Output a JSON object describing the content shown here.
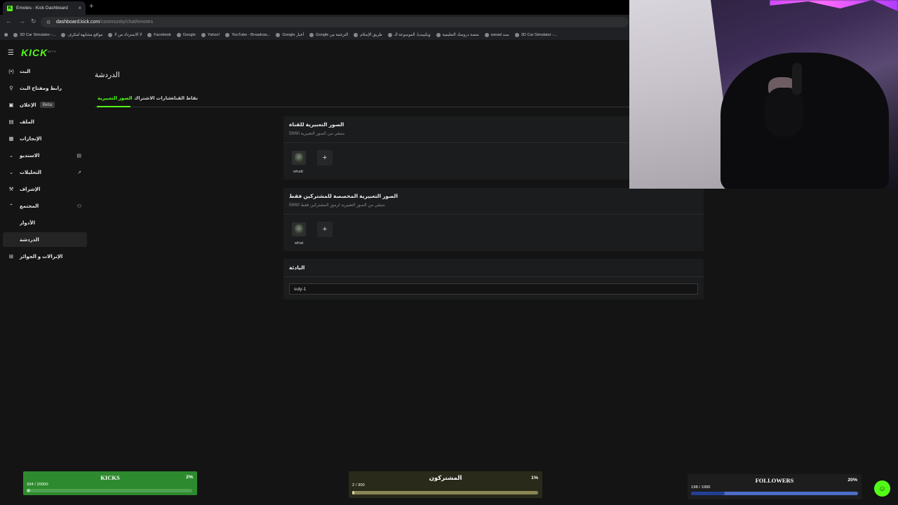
{
  "browser": {
    "tab_title": "Emotes - Kick Dashboard",
    "tab_close": "×",
    "new_tab": "+",
    "url_host": "dashboard.kick.com",
    "url_path": "/community/chat/emotes",
    "bookmarks": [
      "3D Car Simulator -...",
      "مواقع مشابهة لمكرف",
      "لا الاسترداد من لا",
      "Facebook",
      "Google",
      "Yahoo!",
      "YouTube - Broadcas...",
      "Google أخبار",
      "Google الترجمة من",
      "طريق الإسلام",
      "ويكيبيديا، الموسوعة الـ",
      "منصة دروسك التعليمية",
      "sanad سند",
      "3D Car Simulator -..."
    ]
  },
  "sidebar": {
    "logo": "KICK",
    "logo_badge": "BETA",
    "items": [
      {
        "label": "البث",
        "icon": "broadcast-icon",
        "glyph": "(•)"
      },
      {
        "label": "رابط ومفتاح البث",
        "icon": "link-icon",
        "glyph": "⚲"
      },
      {
        "label": "الإعلان",
        "icon": "ad-icon",
        "glyph": "▣",
        "badge": "Beta"
      },
      {
        "label": "الملف",
        "icon": "profile-icon",
        "glyph": "▤"
      },
      {
        "label": "الإنجازات",
        "icon": "achievements-icon",
        "glyph": "▦"
      },
      {
        "label": "الاستديو",
        "icon": "chevron-down-icon",
        "glyph": "⌄",
        "right": "▤"
      },
      {
        "label": "التحليلات",
        "icon": "chevron-down-icon",
        "glyph": "⌄",
        "right": "↗"
      },
      {
        "label": "الإشراف",
        "icon": "wrench-icon",
        "glyph": "⚒"
      },
      {
        "label": "المجتمع",
        "icon": "chevron-up-icon",
        "glyph": "⌃",
        "right": "⚇"
      },
      {
        "label": "الأدوار",
        "sub": true
      },
      {
        "label": "الدردشة",
        "sub": true,
        "active": true
      },
      {
        "label": "الإنزالات و الجوائز",
        "icon": "gift-icon",
        "glyph": "⊞"
      }
    ]
  },
  "main": {
    "title": "الدردشة",
    "tabs": [
      "الصور التعبيرية",
      "شارات الاشتراك",
      "نقاط القناة"
    ],
    "channel_emotes": {
      "title": "الصور التعبيرية للقناة",
      "subtitle": "متبقي من الصور التعبيرية 59/60",
      "emote_name": "whatt",
      "add": "+"
    },
    "sub_emotes": {
      "title": "الصور التعبيرية المخصصة للمشتركين فقط",
      "subtitle": "متبقي من الصور التعبيرية لرموز المشتركين فقط 59/60",
      "emote_name": "what",
      "add": "+"
    },
    "prefix": {
      "title": "البادئة",
      "value": "suly-1"
    }
  },
  "widgets": {
    "kicks": {
      "title": "KICKS",
      "count": "394 / 20000",
      "percent": "2%",
      "progress": 0.02
    },
    "subscribers": {
      "title": "المشتركون",
      "count": "2 / 300",
      "percent": "1%",
      "progress": 0.01
    },
    "followers": {
      "title": "FOLLOWERS",
      "count": "198 / 1000",
      "percent": "20%",
      "progress": 0.2
    }
  },
  "colors": {
    "accent": "#53fc18",
    "kicks_bg": "#2e8a2e",
    "followers_fill": "#3a63c9"
  }
}
